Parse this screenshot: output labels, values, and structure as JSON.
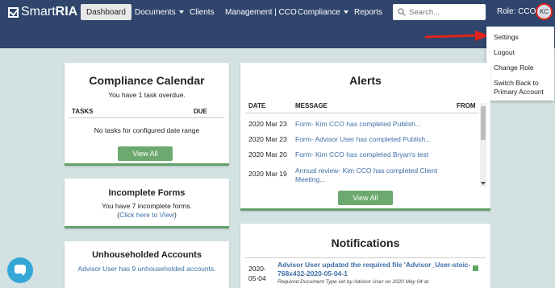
{
  "app": {
    "logo_light": "Smart",
    "logo_bold": "RIA"
  },
  "nav": {
    "dashboard": "Dashboard",
    "documents": "Documents",
    "clients": "Clients",
    "management": "Management | CCO",
    "compliance": "Compliance",
    "reports": "Reports"
  },
  "search": {
    "placeholder": "Search..."
  },
  "user": {
    "role": "Role: CCO",
    "initials": "KC"
  },
  "user_menu": [
    "Settings",
    "Logout",
    "Change Role",
    "Switch Back to",
    "Primary Account"
  ],
  "compliance_calendar": {
    "title": "Compliance Calendar",
    "overdue": "You have 1 task overdue.",
    "col_tasks": "TASKS",
    "col_due": "DUE",
    "empty": "No tasks for configured date range",
    "view_all": "View All"
  },
  "incomplete_forms": {
    "title": "Incomplete Forms",
    "line1": "You have 7 incomplete forms.",
    "line2_prefix": "(",
    "line2_link": "Click here to View",
    "line2_suffix": ")"
  },
  "unhouseholded": {
    "title": "Unhouseholded Accounts",
    "text": "Advisor User has 9 unhouseholded accounts."
  },
  "alerts": {
    "title": "Alerts",
    "col_date": "DATE",
    "col_message": "MESSAGE",
    "col_from": "FROM",
    "rows": [
      {
        "date": "2020 Mar 23",
        "message": "Form- Kim CCO has completed Publish..."
      },
      {
        "date": "2020 Mar 23",
        "message": "Form- Advisor User has completed Publish..."
      },
      {
        "date": "2020 Mar 20",
        "message": "Form- Kim CCO has completed Bryan's test"
      },
      {
        "date": "2020 Mar 19",
        "message": "Annual review- Kim CCO has completed Client",
        "message2": "Meeting..."
      }
    ],
    "view_all": "View All"
  },
  "notifications": {
    "title": "Notifications",
    "date1": "2020-",
    "date2": "05-04",
    "link1": "Advisor User updated the required file 'Advisor_User-stoic-",
    "link2": "768x432-2020-05-04-1",
    "meta": "Required Document Type set by Advisor User on 2020 May 04 at"
  },
  "colors": {
    "navbar": "#2f456c",
    "background": "#d3e1e2",
    "accent_green": "#6da96f",
    "link": "#3d6ea5",
    "annotation_red": "#e0241b"
  }
}
